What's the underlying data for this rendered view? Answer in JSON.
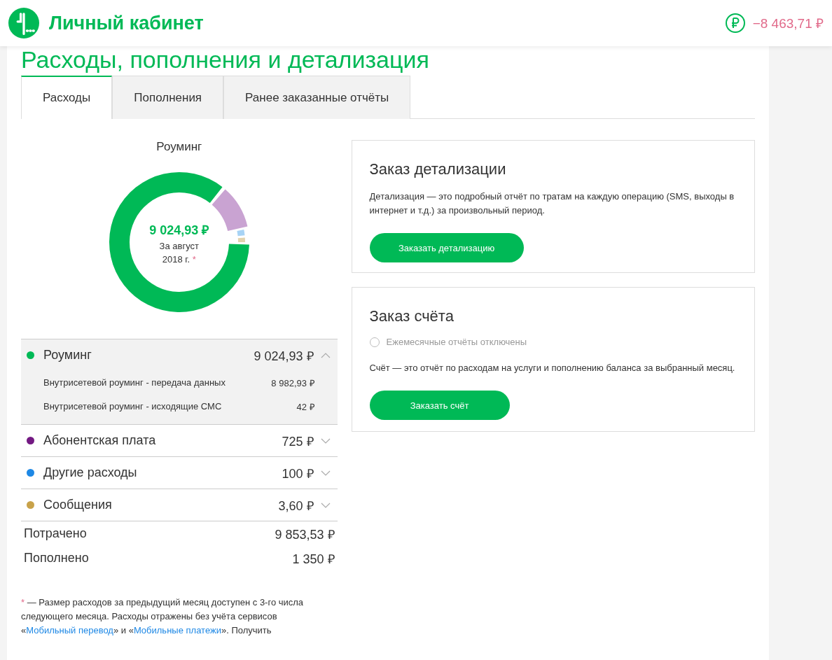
{
  "header": {
    "title": "Личный кабинет",
    "balance": "−8 463,71 ₽"
  },
  "page_title": "Расходы, пополнения и детализация",
  "tabs": [
    {
      "label": "Расходы",
      "selected": true
    },
    {
      "label": "Пополнения",
      "selected": false
    },
    {
      "label": "Ранее заказанные отчёты",
      "selected": false
    }
  ],
  "donut": {
    "title": "Роуминг",
    "amount": "9 024,93 ₽",
    "period": "За август",
    "year": "2018 г.",
    "footnote_mark": "*"
  },
  "categories": [
    {
      "name": "Роуминг",
      "amount": "9 024,93 ₽",
      "color": "#00b956",
      "expanded": true,
      "items": [
        {
          "name": "Внутрисетевой роуминг - передача данных",
          "amount": "8 982,93 ₽"
        },
        {
          "name": "Внутрисетевой роуминг - исходящие СМС",
          "amount": "42 ₽"
        }
      ]
    },
    {
      "name": "Абонентская плата",
      "amount": "725 ₽",
      "color": "#731982",
      "expanded": false
    },
    {
      "name": "Другие расходы",
      "amount": "100 ₽",
      "color": "#1e88e5",
      "expanded": false
    },
    {
      "name": "Сообщения",
      "amount": "3,60 ₽",
      "color": "#c8a24a",
      "expanded": false
    }
  ],
  "totals": [
    {
      "label": "Потрачено",
      "amount": "9 853,53 ₽"
    },
    {
      "label": "Пополнено",
      "amount": "1 350 ₽"
    }
  ],
  "footnote": {
    "mark": "*",
    "text": " — Размер расходов за предыдущий месяц доступен с 3-го числа следующего месяца. Расходы отражены без учёта сервисов «",
    "link1": "Мобильный перевод",
    "middle": "» и «",
    "link2": "Мобильные платежи",
    "end": "». Получить"
  },
  "detail_card": {
    "title": "Заказ детализации",
    "text": "Детализация — это подробный отчёт по тратам на каждую операцию (SMS, выходы в интернет и т.д.) за произвольный период.",
    "button": "Заказать детализацию"
  },
  "bill_card": {
    "title": "Заказ счёта",
    "monthly": {
      "label": "Ежемесячные отчёты отключены",
      "checked": false
    },
    "text": "Счёт — это отчёт по расходам на услуги и пополнению баланса за выбранный месяц.",
    "button": "Заказать счёт"
  }
}
